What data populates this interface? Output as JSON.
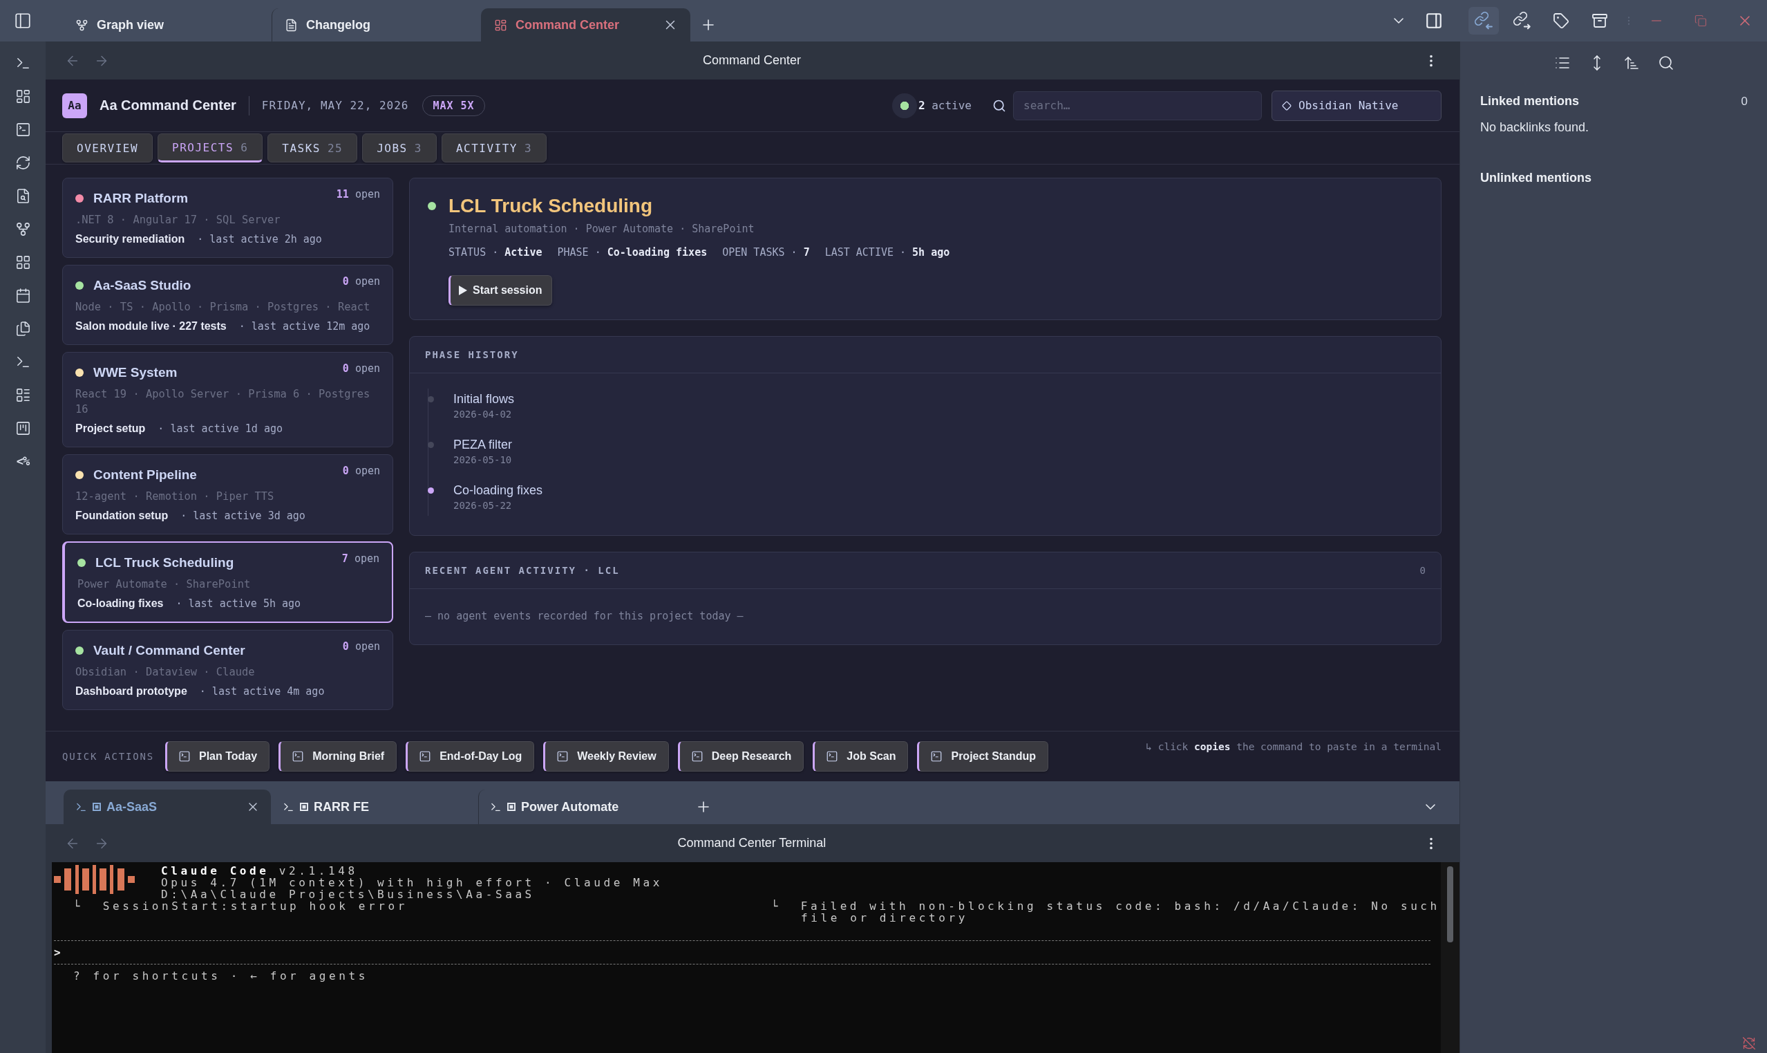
{
  "window_tabs": [
    {
      "kind": "graph",
      "label": "Graph view",
      "selected": false
    },
    {
      "kind": "document",
      "label": "Changelog",
      "selected": false
    },
    {
      "kind": "dashboard",
      "label": "Command Center",
      "selected": true
    }
  ],
  "sidebar_tabs": [
    {
      "kind": "backlinks",
      "selected": true
    },
    {
      "kind": "outgoing_links",
      "selected": false
    },
    {
      "kind": "tags",
      "selected": false
    },
    {
      "kind": "archive",
      "selected": false
    }
  ],
  "ribbon": {
    "template_label": "<%"
  },
  "view_header": {
    "title": "Command Center"
  },
  "dashboard": {
    "badge": "Aa",
    "title": "Aa Command Center",
    "date": "FRIDAY, MAY 22, 2026",
    "plan": "MAX 5X",
    "active_sessions": {
      "count": "2",
      "label": "active"
    },
    "search": {
      "placeholder": "search…"
    },
    "mode_button": {
      "label": "Obsidian Native"
    },
    "tabs": [
      {
        "label": "OVERVIEW",
        "selected": false
      },
      {
        "label": "PROJECTS",
        "count": "6",
        "selected": true
      },
      {
        "label": "TASKS",
        "count": "25",
        "selected": false
      },
      {
        "label": "JOBS",
        "count": "3",
        "selected": false
      },
      {
        "label": "ACTIVITY",
        "count": "3",
        "selected": false
      }
    ],
    "projects": [
      {
        "name": "RARR Platform",
        "color": "#f38ba8",
        "open_count": "11",
        "open_label": "open",
        "stack": ".NET 8 · Angular 17 · SQL Server",
        "phase": "Security remediation",
        "last_active": "· last active 2h ago",
        "selected": false
      },
      {
        "name": "Aa-SaaS Studio",
        "color": "#a6e3a1",
        "open_count": "0",
        "open_label": "open",
        "stack": "Node · TS · Apollo · Prisma · Postgres · React",
        "phase": "Salon module live · 227 tests",
        "last_active": "· last active 12m ago",
        "selected": false
      },
      {
        "name": "WWE System",
        "color": "#f9e2af",
        "open_count": "0",
        "open_label": "open",
        "stack": "React 19 · Apollo Server · Prisma 6 · Postgres 16",
        "phase": "Project setup",
        "last_active": "· last active 1d ago",
        "selected": false
      },
      {
        "name": "Content Pipeline",
        "color": "#f9e2af",
        "open_count": "0",
        "open_label": "open",
        "stack": "12-agent · Remotion · Piper TTS",
        "phase": "Foundation setup",
        "last_active": "· last active 3d ago",
        "selected": false
      },
      {
        "name": "LCL Truck Scheduling",
        "color": "#a6e3a1",
        "open_count": "7",
        "open_label": "open",
        "stack": "Power Automate · SharePoint",
        "phase": "Co-loading fixes",
        "last_active": "· last active 5h ago",
        "selected": true
      },
      {
        "name": "Vault / Command Center",
        "color": "#a6e3a1",
        "open_count": "0",
        "open_label": "open",
        "stack": "Obsidian · Dataview · Claude",
        "phase": "Dashboard prototype",
        "last_active": "· last active 4m ago",
        "selected": false
      }
    ],
    "detail": {
      "name": "LCL Truck Scheduling",
      "subtitle": "Internal automation · Power Automate · SharePoint",
      "meta": [
        {
          "label": "STATUS ·",
          "value": "Active"
        },
        {
          "label": "PHASE ·",
          "value": "Co-loading fixes"
        },
        {
          "label": "OPEN TASKS ·",
          "value": "7"
        },
        {
          "label": "LAST ACTIVE ·",
          "value": "5h ago"
        }
      ],
      "action": "Start session"
    },
    "phase_history": {
      "title": "PHASE HISTORY",
      "items": [
        {
          "name": "Initial flows",
          "date": "2026-04-02",
          "current": false
        },
        {
          "name": "PEZA filter",
          "date": "2026-05-10",
          "current": false
        },
        {
          "name": "Co-loading fixes",
          "date": "2026-05-22",
          "current": true
        }
      ]
    },
    "recent_activity": {
      "title": "RECENT AGENT ACTIVITY · LCL",
      "count": "0",
      "empty_text": "— no agent events recorded for this project today —"
    },
    "quick_actions": {
      "label": "QUICK ACTIONS",
      "buttons": [
        "Plan Today",
        "Morning Brief",
        "End-of-Day Log",
        "Weekly Review",
        "Deep Research",
        "Job Scan",
        "Project Standup"
      ],
      "hint": "↳ click **copies** the command to paste in a terminal"
    }
  },
  "terminal_tabs": [
    {
      "label": "Aa-SaaS",
      "selected": true
    },
    {
      "label": "RARR FE",
      "selected": false
    },
    {
      "label": "Power Automate",
      "selected": false
    }
  ],
  "terminal_header": {
    "title": "Command Center Terminal"
  },
  "terminal": {
    "app_name": "Claude Code",
    "version": "v2.1.148",
    "model": "Opus 4.7 (1M context) with high effort · Claude Max",
    "cwd": "D:\\Aa\\Claude Projects\\Business\\Aa-SaaS",
    "hook_event": "└  SessionStart:startup hook error",
    "hook_message": "└  Failed with non-blocking status code: bash: /d/Aa/Claude: No such file or directory",
    "prompt": ">",
    "hint": "? for shortcuts · ← for agents"
  },
  "backlinks_panel": {
    "linked_title": "Linked mentions",
    "linked_count": "0",
    "linked_empty": "No backlinks found.",
    "unlinked_title": "Unlinked mentions"
  }
}
